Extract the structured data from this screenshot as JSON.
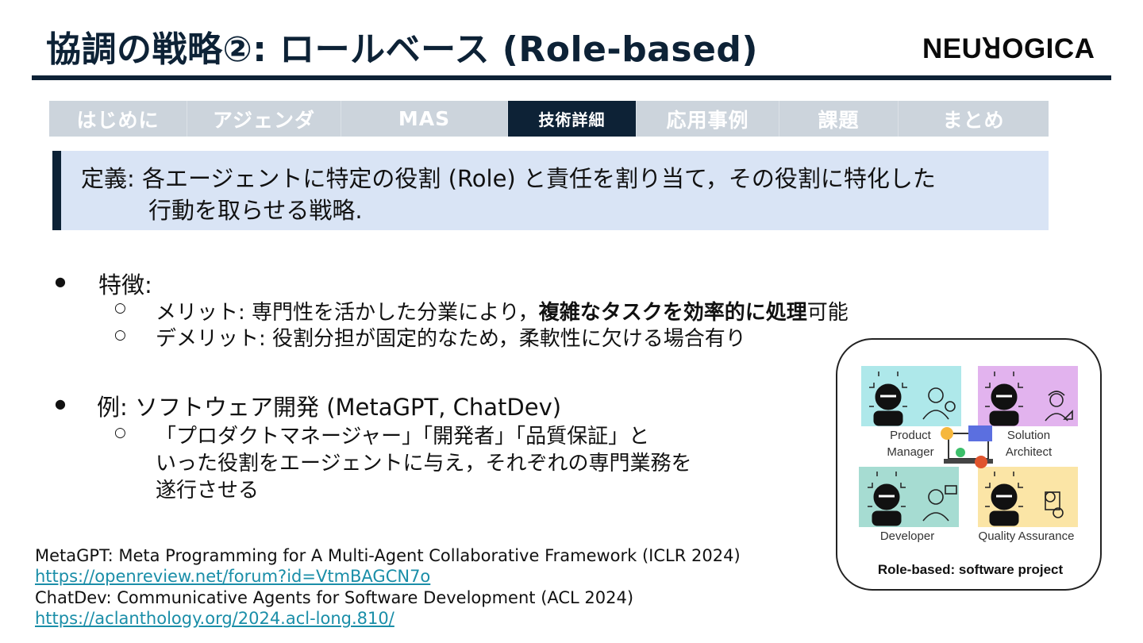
{
  "slide": {
    "title": "協調の戦略②: ロールベース (Role-based)",
    "logo": "NEUꓤOGICA"
  },
  "nav": {
    "tabs": [
      {
        "label": "はじめに",
        "active": false
      },
      {
        "label": "アジェンダ",
        "active": false
      },
      {
        "label": "MAS",
        "active": false
      },
      {
        "label": "技術詳細",
        "active": true
      },
      {
        "label": "応用事例",
        "active": false
      },
      {
        "label": "課題",
        "active": false
      },
      {
        "label": "まとめ",
        "active": false
      }
    ]
  },
  "definition": {
    "line1": "定義: 各エージェントに特定の役割 (Role) と責任を割り当て，その役割に特化した",
    "line2": "行動を取らせる戦略."
  },
  "features": {
    "heading": "特徴:",
    "merit_prefix": "メリット: 専門性を活かした分業により，",
    "merit_bold": "複雑なタスクを効率的に処理",
    "merit_suffix": "可能",
    "demerit": "デメリット: 役割分担が固定的なため，柔軟性に欠ける場合有り"
  },
  "example": {
    "heading": "例: ソフトウェア開発 (MetaGPT, ChatDev)",
    "line1": "「プロダクトマネージャー」「開発者」「品質保証」と",
    "line2": "いった役割をエージェントに与え，それぞれの専門業務を",
    "line3": "遂行させる"
  },
  "references": {
    "ref1": "MetaGPT: Meta Programming for A Multi-Agent Collaborative Framework (ICLR 2024)",
    "ref1_url": "https://openreview.net/forum?id=VtmBAGCN7o",
    "ref2": "ChatDev: Communicative Agents for Software Development (ACL 2024)",
    "ref2_url": "https://aclanthology.org/2024.acl-long.810/"
  },
  "figure": {
    "roles": {
      "pm_line1": "Product",
      "pm_line2": "Manager",
      "sa_line1": "Solution",
      "sa_line2": "Architect",
      "dev": "Developer",
      "qa": "Quality Assurance"
    },
    "caption": "Role-based: software project",
    "colors": {
      "pm": "#aee8ea",
      "sa": "#e2b3ee",
      "dev": "#a6dcd2",
      "qa": "#fbe5a6"
    }
  },
  "colors": {
    "navy": "#0d2236",
    "tab_inactive": "#ccd4dc",
    "def_bg": "#d9e4f5",
    "link": "#1a8ea8"
  }
}
